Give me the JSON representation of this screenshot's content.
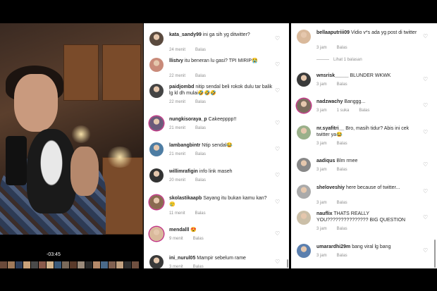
{
  "video": {
    "timer": "-03:45"
  },
  "left_comments": [
    {
      "user": "kata_sandy99",
      "text": "ini ga sih yg ditwitter?",
      "time": "24 menit",
      "reply": "Balas"
    },
    {
      "user": "llistvy",
      "text": "itu beneran lu gasi? TPI MIRIP😭",
      "time": "22 menit",
      "reply": "Balas"
    },
    {
      "user": "paidjombd",
      "text": "nitip sendal beli rokok dulu tar balik lg kl dh mulai🤣🤣🤣",
      "time": "22 menit",
      "reply": "Balas"
    },
    {
      "user": "nungkisoraya_p",
      "text": "Cakeepppp!!",
      "time": "21 menit",
      "reply": "Balas"
    },
    {
      "user": "lambangbintr",
      "text": "Ntip sendal😂",
      "time": "21 menit",
      "reply": "Balas"
    },
    {
      "user": "willimrafigin",
      "text": "info link maseh",
      "time": "20 menit",
      "reply": "Balas"
    },
    {
      "user": "skolastikaapb",
      "text": "Sayang itu bukan kamu kan? 🥲",
      "time": "11 menit",
      "reply": "Balas"
    },
    {
      "user": "mendalll",
      "text": "😍",
      "time": "9 menit",
      "reply": "Balas"
    },
    {
      "user": "ini_nurul05",
      "text": "Mampir sebelum rame",
      "time": "3 menit",
      "reply": "Balas"
    }
  ],
  "right_comments": [
    {
      "user": "bellaaputriii09",
      "text": "Vidio v*s ada yg post di twitter",
      "time": "3 jam",
      "likes": "",
      "reply": "Balas",
      "replies": "Lihat 1 balasan"
    },
    {
      "user": "wnsrisk_____",
      "text": "BLUNDER WKWK",
      "time": "3 jam",
      "likes": "",
      "reply": "Balas",
      "replies": ""
    },
    {
      "user": "nadzwachy",
      "text": "Banggg...",
      "time": "3 jam",
      "likes": "1 suka",
      "reply": "Balas",
      "replies": ""
    },
    {
      "user": "nr.syafitri__",
      "text": "Bro, masih tidur? Abis ini cek twitter ya😂",
      "time": "3 jam",
      "likes": "",
      "reply": "Balas",
      "replies": ""
    },
    {
      "user": "aadiqus",
      "text": "Blm rmee",
      "time": "3 jam",
      "likes": "",
      "reply": "Balas",
      "replies": ""
    },
    {
      "user": "sheloveshiy",
      "text": "here because of twitter...",
      "time": "3 jam",
      "likes": "",
      "reply": "Balas",
      "replies": ""
    },
    {
      "user": "nauflix",
      "text": "THATS REALLY YOU??????????????? BIG QUESTION",
      "time": "3 jam",
      "likes": "",
      "reply": "Balas",
      "replies": ""
    },
    {
      "user": "umarardhi29m",
      "text": "bang viral lg bang",
      "time": "3 jam",
      "likes": "",
      "reply": "Balas",
      "replies": ""
    }
  ],
  "icons": {
    "heart": "heart-icon"
  },
  "colors": {
    "story_ring": "#c13584",
    "text": "#262626",
    "meta": "#8e8e8e"
  }
}
